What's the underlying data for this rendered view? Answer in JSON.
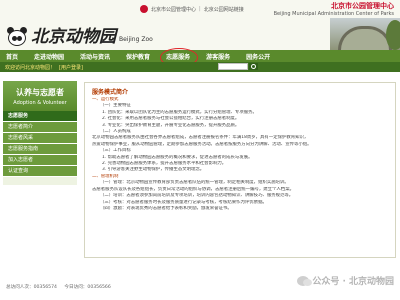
{
  "header": {
    "logo_text": "北京动物园",
    "logo_en": "Beijing Zoo",
    "gov_links": [
      "北京市公园管理中心",
      "北京公园网站链接"
    ],
    "gov_title_cn": "北京市公园管理中心",
    "gov_title_en": "Beijing Municipal Administration Center of Parks"
  },
  "nav": {
    "items": [
      {
        "label": "首页"
      },
      {
        "label": "走进动物园"
      },
      {
        "label": "活动与资讯"
      },
      {
        "label": "保护教育"
      },
      {
        "label": "志愿服务"
      },
      {
        "label": "游客服务"
      },
      {
        "label": "园务公开"
      }
    ],
    "active_index": 4
  },
  "welcome": {
    "text": "欢迎访问北京动物园！",
    "user_link": "[用户登录]"
  },
  "sidebar": {
    "title_cn": "认养与志愿者",
    "title_en": "Adoption & Volunteer",
    "items": [
      {
        "label": "志愿服务",
        "kind": "first"
      },
      {
        "label": "志愿者简介",
        "kind": "sub"
      },
      {
        "label": "志愿者风采",
        "kind": "sub"
      },
      {
        "label": "志愿服务指南",
        "kind": "sub"
      },
      {
        "label": "加入志愿者",
        "kind": "sub"
      },
      {
        "label": "认证查询",
        "kind": "sub"
      }
    ]
  },
  "content": {
    "title": "服务模式简介",
    "lines": [
      {
        "text": "一、运行模式",
        "kind": "hd"
      },
      {
        "text": "（一）主要特征",
        "kind": "sub"
      },
      {
        "text": "1. 团队化：采取以团队化为主的志愿服务运行模式，实行分组管理、专项服务。",
        "kind": "indent"
      },
      {
        "text": "2. 社会化：采用志愿者服务与社会公益相结合，实行注册志愿者制度。",
        "kind": "indent"
      },
      {
        "text": "3. 专业化：突出保护教育主题，开展专业化志愿服务，提升服务品质。",
        "kind": "indent"
      },
      {
        "text": "（二）人员构成",
        "kind": "sub"
      },
      {
        "text": "北京动物园志愿者服务队由社会各界志愿者组成，志愿者注册报名条件：年满18周岁，具有一定保护教育知识，",
        "kind": "norm"
      },
      {
        "text": "热爱动物保护事业，服从动物园管理，定期参加志愿服务活动。志愿者按服务方向分为讲解、活动、宣传等小组。",
        "kind": "norm"
      },
      {
        "text": "（三）工作目标",
        "kind": "sub"
      },
      {
        "text": "1. 帮助志愿者了解动物园志愿服务的概况和要求，促进志愿者的成长与发展。",
        "kind": "indent"
      },
      {
        "text": "2. 完善动物园志愿服务体系，提升志愿服务水平和社会影响力。",
        "kind": "indent"
      },
      {
        "text": "3. 引导游客关注野生动物保护，传播生态文明理念。",
        "kind": "indent"
      },
      {
        "text": "二、管理机制",
        "kind": "hd"
      },
      {
        "text": "（一）管理：北京动物园宣传教育部负责志愿者队伍的统一管理，制定相关制度，组织实施培训。",
        "kind": "sub"
      },
      {
        "text": "志愿者服务队设队长及各组组长，负责日常活动的组织与协调，志愿者注册后统一编号，建立个人档案。",
        "kind": "norm"
      },
      {
        "text": "（二）培训：志愿者须参加岗前培训及专项培训，培训内容包括动物知识、讲解技巧、服务规范等。",
        "kind": "sub"
      },
      {
        "text": "（三）考核：对志愿者服务时长及服务质量进行记录与考核，考核结果作为评优依据。",
        "kind": "sub"
      },
      {
        "text": "（四）激励：对表现优秀的志愿者给予表彰和奖励，颁发荣誉证书。",
        "kind": "sub"
      }
    ]
  },
  "footer": {
    "stats": [
      "总访问人次：00356574",
      "今日访问：00356566"
    ],
    "watermark": "公众号 · 北京动物园"
  },
  "colors": {
    "nav_bg": "#5a8a2c",
    "welcome_bg": "#3f7020",
    "accent_red": "#e0262b",
    "heading_brown": "#b23a00"
  }
}
